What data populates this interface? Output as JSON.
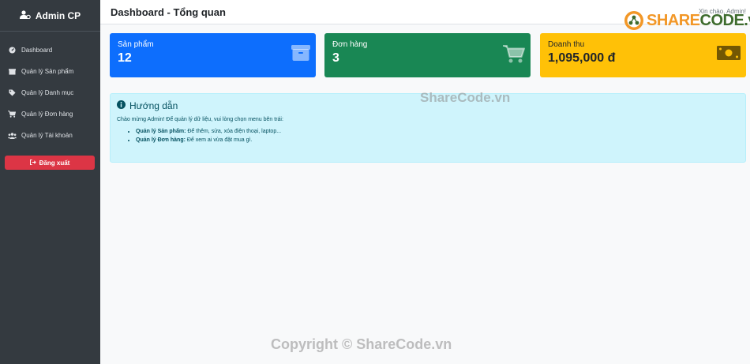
{
  "sidebar": {
    "brand": "Admin CP",
    "items": [
      {
        "label": "Dashboard",
        "icon": "gauge-icon"
      },
      {
        "label": "Quản lý Sản phẩm",
        "icon": "box-icon"
      },
      {
        "label": "Quản lý Danh mục",
        "icon": "tag-icon"
      },
      {
        "label": "Quản lý Đơn hàng",
        "icon": "cart-icon"
      },
      {
        "label": "Quản lý Tài khoản",
        "icon": "users-icon"
      }
    ],
    "logout": "Đăng xuất",
    "logout_color": "#dc3545"
  },
  "header": {
    "title": "Dashboard - Tổng quan",
    "greeting": "Xin chào, Admin!"
  },
  "logo": {
    "share": "SHARE",
    "code": "CODE.vn"
  },
  "stats": [
    {
      "label": "Sản phẩm",
      "value": "12",
      "color": "#0d6efd",
      "icon": "box-icon"
    },
    {
      "label": "Đơn hàng",
      "value": "3",
      "color": "#198754",
      "icon": "cart-icon"
    },
    {
      "label": "Doanh thu",
      "value": "1,095,000 đ",
      "color": "#ffc107",
      "icon": "money-icon"
    }
  ],
  "guide": {
    "title": "Hướng dẫn",
    "intro": "Chào mừng Admin! Để quản lý dữ liệu, vui lòng chọn menu bên trái:",
    "items": [
      {
        "bold": "Quản lý Sản phẩm:",
        "text": " Để thêm, sửa, xóa điện thoại, laptop..."
      },
      {
        "bold": "Quản lý Đơn hàng:",
        "text": " Để xem ai vừa đặt mua gì."
      }
    ]
  },
  "watermarks": {
    "center": "ShareCode.vn",
    "bottom": "Copyright © ShareCode.vn"
  }
}
